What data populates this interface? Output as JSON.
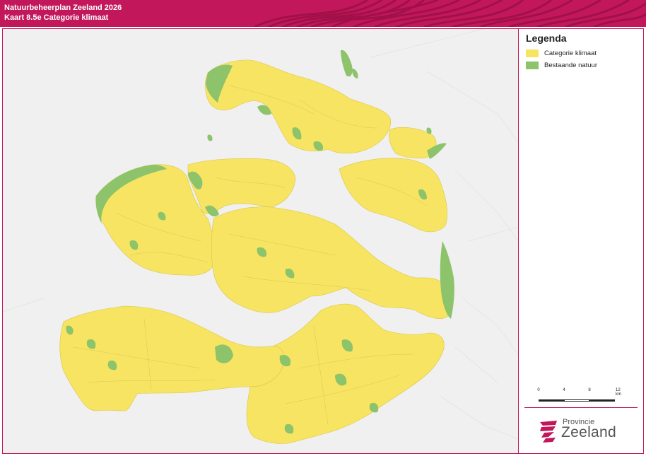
{
  "header": {
    "title_line1": "Natuurbeheerplan Zeeland 2026",
    "title_line2": "Kaart 8.5e Categorie klimaat",
    "color": "#c2185b"
  },
  "legend": {
    "title": "Legenda",
    "items": [
      {
        "label": "Categorie klimaat",
        "color": "#f7e463"
      },
      {
        "label": "Bestaande natuur",
        "color": "#8cc36b"
      }
    ]
  },
  "scale": {
    "labels": [
      "0",
      "4",
      "8",
      "12 km"
    ]
  },
  "logo": {
    "line1": "Provincie",
    "line2": "Zeeland",
    "icon": "zeeland-logo-icon"
  },
  "colors": {
    "klimaat": "#f7e463",
    "natuur": "#8cc36b",
    "background": "#f0f0f0",
    "water": "#f5f5f5"
  }
}
